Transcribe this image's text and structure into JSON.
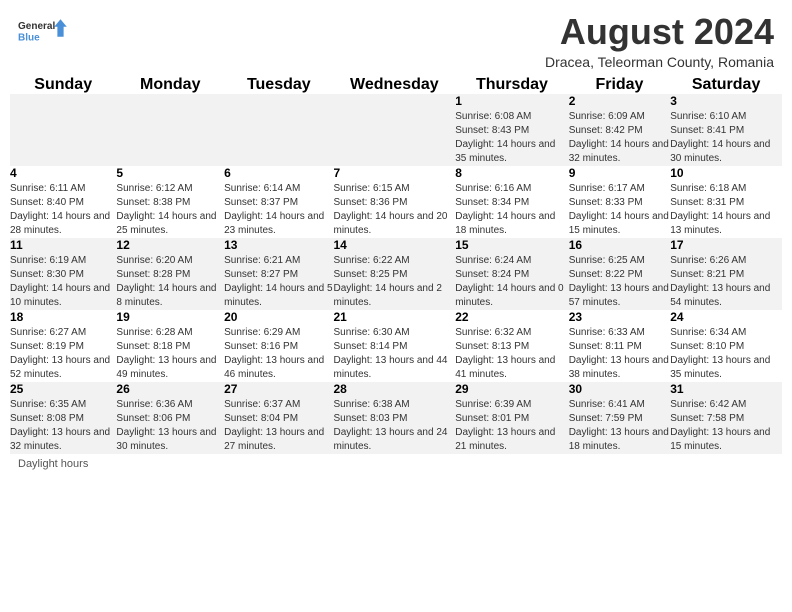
{
  "header": {
    "logo_general": "General",
    "logo_blue": "Blue",
    "month_year": "August 2024",
    "location": "Dracea, Teleorman County, Romania"
  },
  "days_of_week": [
    "Sunday",
    "Monday",
    "Tuesday",
    "Wednesday",
    "Thursday",
    "Friday",
    "Saturday"
  ],
  "weeks": [
    [
      {
        "day": "",
        "info": ""
      },
      {
        "day": "",
        "info": ""
      },
      {
        "day": "",
        "info": ""
      },
      {
        "day": "",
        "info": ""
      },
      {
        "day": "1",
        "info": "Sunrise: 6:08 AM\nSunset: 8:43 PM\nDaylight: 14 hours and 35 minutes."
      },
      {
        "day": "2",
        "info": "Sunrise: 6:09 AM\nSunset: 8:42 PM\nDaylight: 14 hours and 32 minutes."
      },
      {
        "day": "3",
        "info": "Sunrise: 6:10 AM\nSunset: 8:41 PM\nDaylight: 14 hours and 30 minutes."
      }
    ],
    [
      {
        "day": "4",
        "info": "Sunrise: 6:11 AM\nSunset: 8:40 PM\nDaylight: 14 hours and 28 minutes."
      },
      {
        "day": "5",
        "info": "Sunrise: 6:12 AM\nSunset: 8:38 PM\nDaylight: 14 hours and 25 minutes."
      },
      {
        "day": "6",
        "info": "Sunrise: 6:14 AM\nSunset: 8:37 PM\nDaylight: 14 hours and 23 minutes."
      },
      {
        "day": "7",
        "info": "Sunrise: 6:15 AM\nSunset: 8:36 PM\nDaylight: 14 hours and 20 minutes."
      },
      {
        "day": "8",
        "info": "Sunrise: 6:16 AM\nSunset: 8:34 PM\nDaylight: 14 hours and 18 minutes."
      },
      {
        "day": "9",
        "info": "Sunrise: 6:17 AM\nSunset: 8:33 PM\nDaylight: 14 hours and 15 minutes."
      },
      {
        "day": "10",
        "info": "Sunrise: 6:18 AM\nSunset: 8:31 PM\nDaylight: 14 hours and 13 minutes."
      }
    ],
    [
      {
        "day": "11",
        "info": "Sunrise: 6:19 AM\nSunset: 8:30 PM\nDaylight: 14 hours and 10 minutes."
      },
      {
        "day": "12",
        "info": "Sunrise: 6:20 AM\nSunset: 8:28 PM\nDaylight: 14 hours and 8 minutes."
      },
      {
        "day": "13",
        "info": "Sunrise: 6:21 AM\nSunset: 8:27 PM\nDaylight: 14 hours and 5 minutes."
      },
      {
        "day": "14",
        "info": "Sunrise: 6:22 AM\nSunset: 8:25 PM\nDaylight: 14 hours and 2 minutes."
      },
      {
        "day": "15",
        "info": "Sunrise: 6:24 AM\nSunset: 8:24 PM\nDaylight: 14 hours and 0 minutes."
      },
      {
        "day": "16",
        "info": "Sunrise: 6:25 AM\nSunset: 8:22 PM\nDaylight: 13 hours and 57 minutes."
      },
      {
        "day": "17",
        "info": "Sunrise: 6:26 AM\nSunset: 8:21 PM\nDaylight: 13 hours and 54 minutes."
      }
    ],
    [
      {
        "day": "18",
        "info": "Sunrise: 6:27 AM\nSunset: 8:19 PM\nDaylight: 13 hours and 52 minutes."
      },
      {
        "day": "19",
        "info": "Sunrise: 6:28 AM\nSunset: 8:18 PM\nDaylight: 13 hours and 49 minutes."
      },
      {
        "day": "20",
        "info": "Sunrise: 6:29 AM\nSunset: 8:16 PM\nDaylight: 13 hours and 46 minutes."
      },
      {
        "day": "21",
        "info": "Sunrise: 6:30 AM\nSunset: 8:14 PM\nDaylight: 13 hours and 44 minutes."
      },
      {
        "day": "22",
        "info": "Sunrise: 6:32 AM\nSunset: 8:13 PM\nDaylight: 13 hours and 41 minutes."
      },
      {
        "day": "23",
        "info": "Sunrise: 6:33 AM\nSunset: 8:11 PM\nDaylight: 13 hours and 38 minutes."
      },
      {
        "day": "24",
        "info": "Sunrise: 6:34 AM\nSunset: 8:10 PM\nDaylight: 13 hours and 35 minutes."
      }
    ],
    [
      {
        "day": "25",
        "info": "Sunrise: 6:35 AM\nSunset: 8:08 PM\nDaylight: 13 hours and 32 minutes."
      },
      {
        "day": "26",
        "info": "Sunrise: 6:36 AM\nSunset: 8:06 PM\nDaylight: 13 hours and 30 minutes."
      },
      {
        "day": "27",
        "info": "Sunrise: 6:37 AM\nSunset: 8:04 PM\nDaylight: 13 hours and 27 minutes."
      },
      {
        "day": "28",
        "info": "Sunrise: 6:38 AM\nSunset: 8:03 PM\nDaylight: 13 hours and 24 minutes."
      },
      {
        "day": "29",
        "info": "Sunrise: 6:39 AM\nSunset: 8:01 PM\nDaylight: 13 hours and 21 minutes."
      },
      {
        "day": "30",
        "info": "Sunrise: 6:41 AM\nSunset: 7:59 PM\nDaylight: 13 hours and 18 minutes."
      },
      {
        "day": "31",
        "info": "Sunrise: 6:42 AM\nSunset: 7:58 PM\nDaylight: 13 hours and 15 minutes."
      }
    ]
  ],
  "footer": {
    "daylight_label": "Daylight hours"
  }
}
